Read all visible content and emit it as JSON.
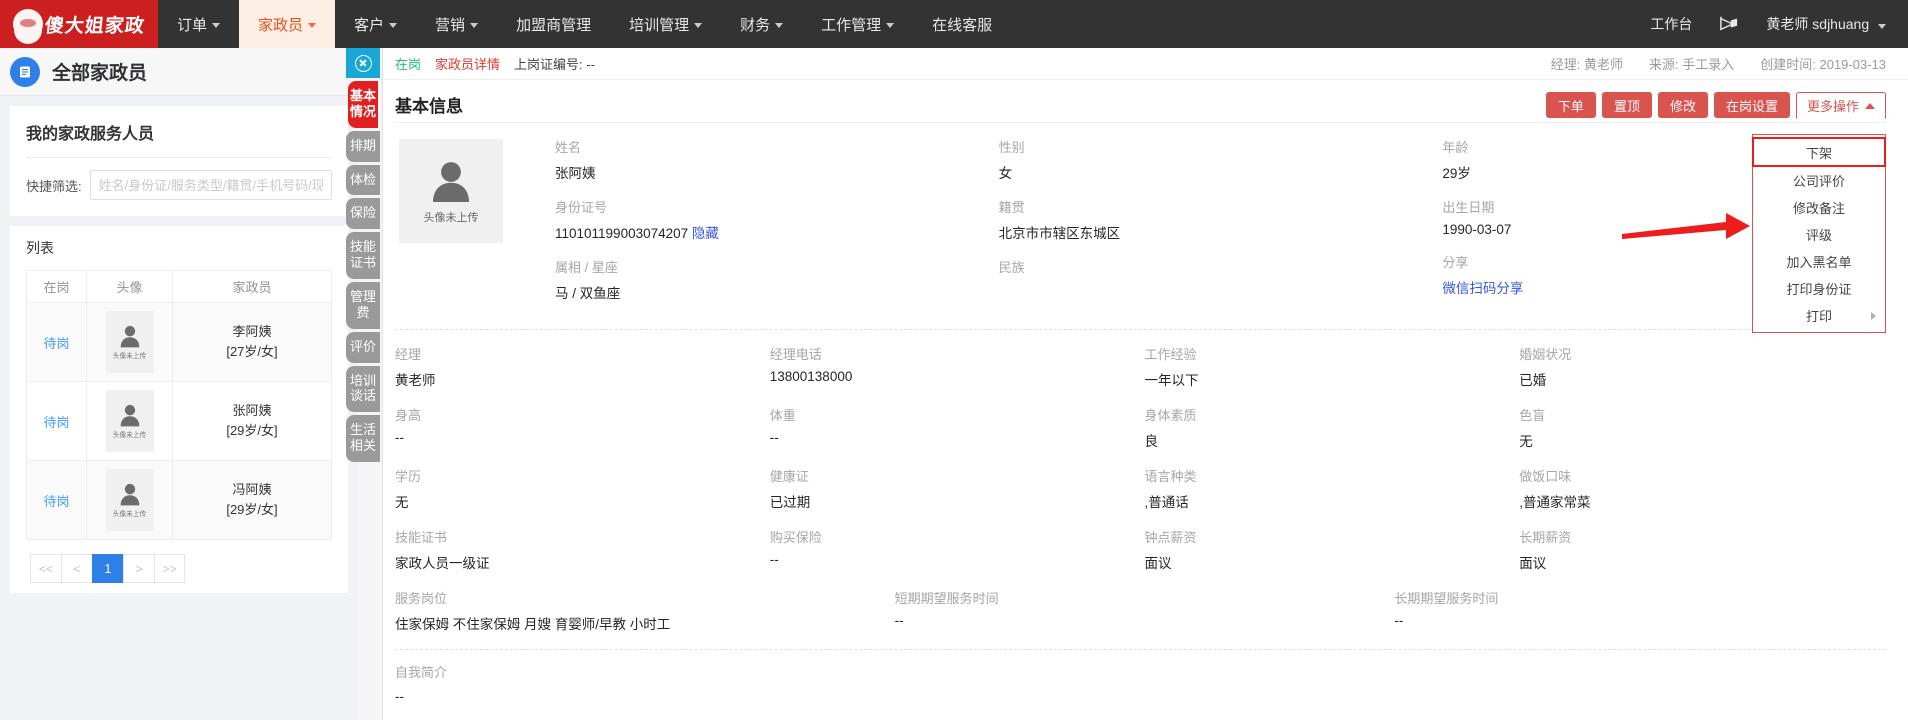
{
  "topnav": {
    "logo_text": "傻大姐家政",
    "items": [
      {
        "label": "订单",
        "caret": true,
        "active": false
      },
      {
        "label": "家政员",
        "caret": true,
        "active": true
      },
      {
        "label": "客户",
        "caret": true,
        "active": false
      },
      {
        "label": "营销",
        "caret": true,
        "active": false
      },
      {
        "label": "加盟商管理",
        "caret": false,
        "active": false
      },
      {
        "label": "培训管理",
        "caret": true,
        "active": false
      },
      {
        "label": "财务",
        "caret": true,
        "active": false
      },
      {
        "label": "工作管理",
        "caret": true,
        "active": false
      },
      {
        "label": "在线客服",
        "caret": false,
        "active": false
      }
    ],
    "workbench": "工作台",
    "user": "黄老师 sdjhuang"
  },
  "leftpanel": {
    "page_title": "全部家政员",
    "card_title": "我的家政服务人员",
    "filter_label": "快捷筛选:",
    "filter_placeholder": "姓名/身份证/服务类型/籍贯/手机号码/现",
    "filter_value": "",
    "list_title": "列表",
    "columns": [
      "在岗",
      "头像",
      "家政员"
    ],
    "avatar_caption": "头像未上传",
    "rows": [
      {
        "status": "待岗",
        "name": "李阿姨",
        "meta": "[27岁/女]"
      },
      {
        "status": "待岗",
        "name": "张阿姨",
        "meta": "[29岁/女]"
      },
      {
        "status": "待岗",
        "name": "冯阿姨",
        "meta": "[29岁/女]"
      }
    ],
    "pager": [
      "<<",
      "<",
      "1",
      ">",
      ">>"
    ],
    "pager_current": "1"
  },
  "vtabs": {
    "close_label": "关闭",
    "items": [
      {
        "label": "基本情况",
        "active": true
      },
      {
        "label": "排期",
        "active": false
      },
      {
        "label": "体检",
        "active": false
      },
      {
        "label": "保险",
        "active": false
      },
      {
        "label": "技能证书",
        "active": false
      },
      {
        "label": "管理费",
        "active": false
      },
      {
        "label": "评价",
        "active": false
      },
      {
        "label": "培训谈话",
        "active": false
      },
      {
        "label": "生活相关",
        "active": false
      }
    ]
  },
  "detail": {
    "crumb_status": "在岗",
    "crumb_page": "家政员详情",
    "crumb_cert": "上岗证编号: --",
    "meta_manager": "经理: 黄老师",
    "meta_source": "来源: 手工录入",
    "meta_created": "创建时间: 2019-03-13",
    "section_title": "基本信息",
    "buttons": [
      {
        "label": "下单"
      },
      {
        "label": "置顶"
      },
      {
        "label": "修改"
      },
      {
        "label": "在岗设置"
      }
    ],
    "more_label": "更多操作",
    "dropdown": [
      {
        "label": "下架",
        "highlighted": true,
        "submenu": false
      },
      {
        "label": "公司评价",
        "highlighted": false,
        "submenu": false
      },
      {
        "label": "修改备注",
        "highlighted": false,
        "submenu": false
      },
      {
        "label": "评级",
        "highlighted": false,
        "submenu": false
      },
      {
        "label": "加入黑名单",
        "highlighted": false,
        "submenu": false
      },
      {
        "label": "打印身份证",
        "highlighted": false,
        "submenu": false
      },
      {
        "label": "打印",
        "highlighted": false,
        "submenu": true
      }
    ],
    "avatar_caption": "头像未上传",
    "top_fields": [
      [
        {
          "label": "姓名",
          "value": "张阿姨"
        },
        {
          "label": "身份证号",
          "value": "110101199003074207",
          "link": "隐藏"
        },
        {
          "label": "属相 / 星座",
          "value": "马 / 双鱼座"
        }
      ],
      [
        {
          "label": "性别",
          "value": "女"
        },
        {
          "label": "籍贯",
          "value": "北京市市辖区东城区"
        },
        {
          "label": "民族",
          "value": ""
        }
      ],
      [
        {
          "label": "年龄",
          "value": "29岁"
        },
        {
          "label": "出生日期",
          "value": "1990-03-07"
        },
        {
          "label": "分享",
          "value": "",
          "link": "微信扫码分享"
        }
      ]
    ],
    "lower_fields": [
      {
        "label": "经理",
        "value": "黄老师"
      },
      {
        "label": "经理电话",
        "value": "13800138000"
      },
      {
        "label": "工作经验",
        "value": "一年以下"
      },
      {
        "label": "婚姻状况",
        "value": "已婚"
      },
      {
        "label": "身高",
        "value": "--"
      },
      {
        "label": "体重",
        "value": "--"
      },
      {
        "label": "身体素质",
        "value": "良"
      },
      {
        "label": "色盲",
        "value": "无"
      },
      {
        "label": "学历",
        "value": "无"
      },
      {
        "label": "健康证",
        "value": "已过期"
      },
      {
        "label": "语言种类",
        "value": ",普通话"
      },
      {
        "label": "做饭口味",
        "value": ",普通家常菜"
      },
      {
        "label": "技能证书",
        "value": "家政人员一级证"
      },
      {
        "label": "购买保险",
        "value": "--"
      },
      {
        "label": "钟点薪资",
        "value": "面议"
      },
      {
        "label": "长期薪资",
        "value": "面议"
      }
    ],
    "service_fields": [
      {
        "label": "服务岗位",
        "value": "住家保姆 不住家保姆 月嫂 育婴师/早教 小时工"
      },
      {
        "label": "短期期望服务时间",
        "value": "--"
      },
      {
        "label": "长期期望服务时间",
        "value": "--"
      }
    ],
    "intro": {
      "label": "自我简介",
      "value": "--"
    }
  },
  "colors": {
    "brand_red": "#cc1f1f",
    "nav_dark": "#333333",
    "active_tab_bg": "#fdeee4",
    "active_tab_text": "#e8541e",
    "button_red": "#d9534f",
    "highlight_red": "#ee1c1c",
    "link_blue": "#409eff",
    "accent_blue": "#2f7fe8",
    "cyan": "#19a7d8",
    "tab_gray": "#9a9a9a",
    "green": "#21ba72"
  }
}
